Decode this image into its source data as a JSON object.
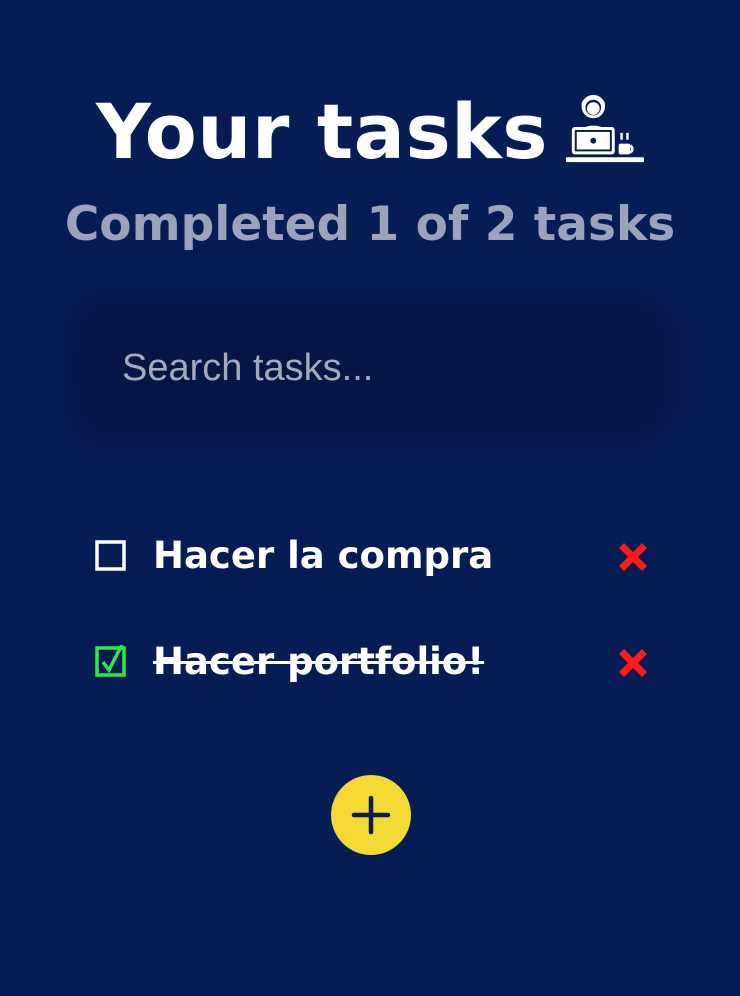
{
  "header": {
    "title": "Your tasks",
    "title_icon": "person-at-laptop-with-coffee-icon",
    "subtitle": "Completed 1 of 2 tasks"
  },
  "search": {
    "placeholder": "Search tasks...",
    "value": ""
  },
  "tasks": [
    {
      "label": "Hacer la compra",
      "completed": false
    },
    {
      "label": "Hacer portfolio!",
      "completed": true
    }
  ],
  "icons": {
    "checkbox_empty": "empty-checkbox-icon",
    "checkbox_checked": "checked-checkbox-icon",
    "delete": "red-x-delete-icon",
    "add": "plus-icon"
  },
  "colors": {
    "background": "#061c54",
    "search_background": "#041643",
    "subtitle": "#9aa3b9",
    "checked": "#2ee845",
    "delete": "#ff1a1a",
    "add_button": "#f2d933",
    "add_icon": "#0b1c4d"
  }
}
